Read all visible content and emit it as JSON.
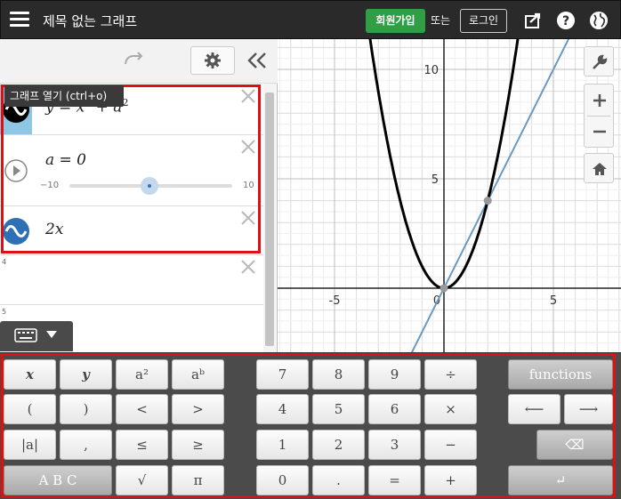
{
  "header": {
    "title": "제목 없는 그래프",
    "signup_label": "회원가입",
    "or_label": "또는",
    "login_label": "로그인"
  },
  "toolbar": {
    "tooltip": "그래프 열기 (ctrl+o)"
  },
  "expressions": [
    {
      "latex_text": "y = x² + a²",
      "base": "y = x",
      "exp1": "2",
      "mid": " + a",
      "exp2": "2"
    },
    {
      "latex_text": "a = 0",
      "slider_min": "−10",
      "slider_max": "10",
      "slider_value": 0
    },
    {
      "latex_text": "2x"
    }
  ],
  "row_numbers": [
    "4",
    "5"
  ],
  "graph": {
    "x_ticks": [
      "-5",
      "0",
      "5"
    ],
    "y_ticks": [
      "5",
      "10"
    ],
    "intersection_point": [
      2,
      4
    ]
  },
  "keypad": {
    "left": [
      [
        "x",
        "y",
        "a²",
        "aᵇ"
      ],
      [
        "(",
        ")",
        "<",
        ">"
      ],
      [
        "|a|",
        ",",
        "≤",
        "≥"
      ],
      [
        "A B C",
        "√",
        "π"
      ]
    ],
    "numpad": [
      [
        "7",
        "8",
        "9",
        "÷"
      ],
      [
        "4",
        "5",
        "6",
        "×"
      ],
      [
        "1",
        "2",
        "3",
        "−"
      ],
      [
        "0",
        ".",
        "=",
        "+"
      ]
    ],
    "functions_label": "functions",
    "left_arrow": "⟵",
    "right_arrow": "⟶",
    "backspace_icon": "⌫",
    "enter_icon": "↵"
  },
  "colors": {
    "topbar": "#2a2a2a",
    "signup": "#2f9e44",
    "parabola": "#000000",
    "line": "#6a9bbf",
    "highlight": "#d11111"
  }
}
